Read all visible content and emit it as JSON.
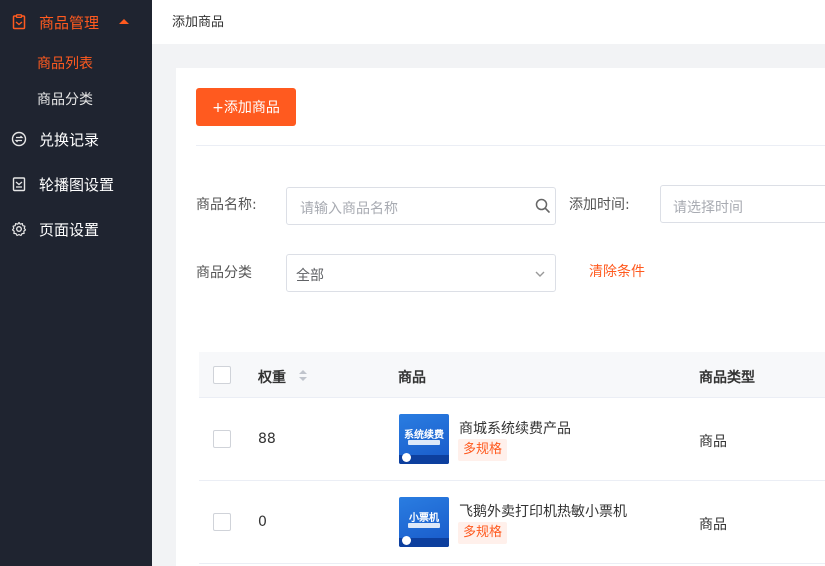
{
  "sidebar": {
    "items": [
      {
        "label": "商品管理",
        "icon": "clipboard-icon",
        "active": true,
        "expanded": true
      },
      {
        "label": "兑换记录",
        "icon": "exchange-icon"
      },
      {
        "label": "轮播图设置",
        "icon": "carousel-icon"
      },
      {
        "label": "页面设置",
        "icon": "gear-icon"
      }
    ],
    "subitems": [
      {
        "label": "商品列表",
        "active": true
      },
      {
        "label": "商品分类"
      }
    ]
  },
  "topbar": {
    "title": "添加商品"
  },
  "toolbar": {
    "add_label": "+添加商品"
  },
  "filters": {
    "name_label": "商品名称:",
    "name_placeholder": "请输入商品名称",
    "time_label": "添加时间:",
    "time_placeholder": "请选择时间",
    "category_label": "商品分类",
    "category_value": "全部",
    "clear_label": "清除条件"
  },
  "table": {
    "columns": [
      "权重",
      "商品",
      "商品类型"
    ],
    "rows": [
      {
        "weight": "88",
        "thumb_text": "系统续费",
        "name": "商城系统续费产品",
        "tag": "多规格",
        "type": "商品"
      },
      {
        "weight": "0",
        "thumb_text": "小票机",
        "name": "飞鹅外卖打印机热敏小票机",
        "tag": "多规格",
        "type": "商品"
      }
    ]
  },
  "colors": {
    "accent": "#ff5a1f",
    "sidebar_bg": "#1f2430"
  }
}
